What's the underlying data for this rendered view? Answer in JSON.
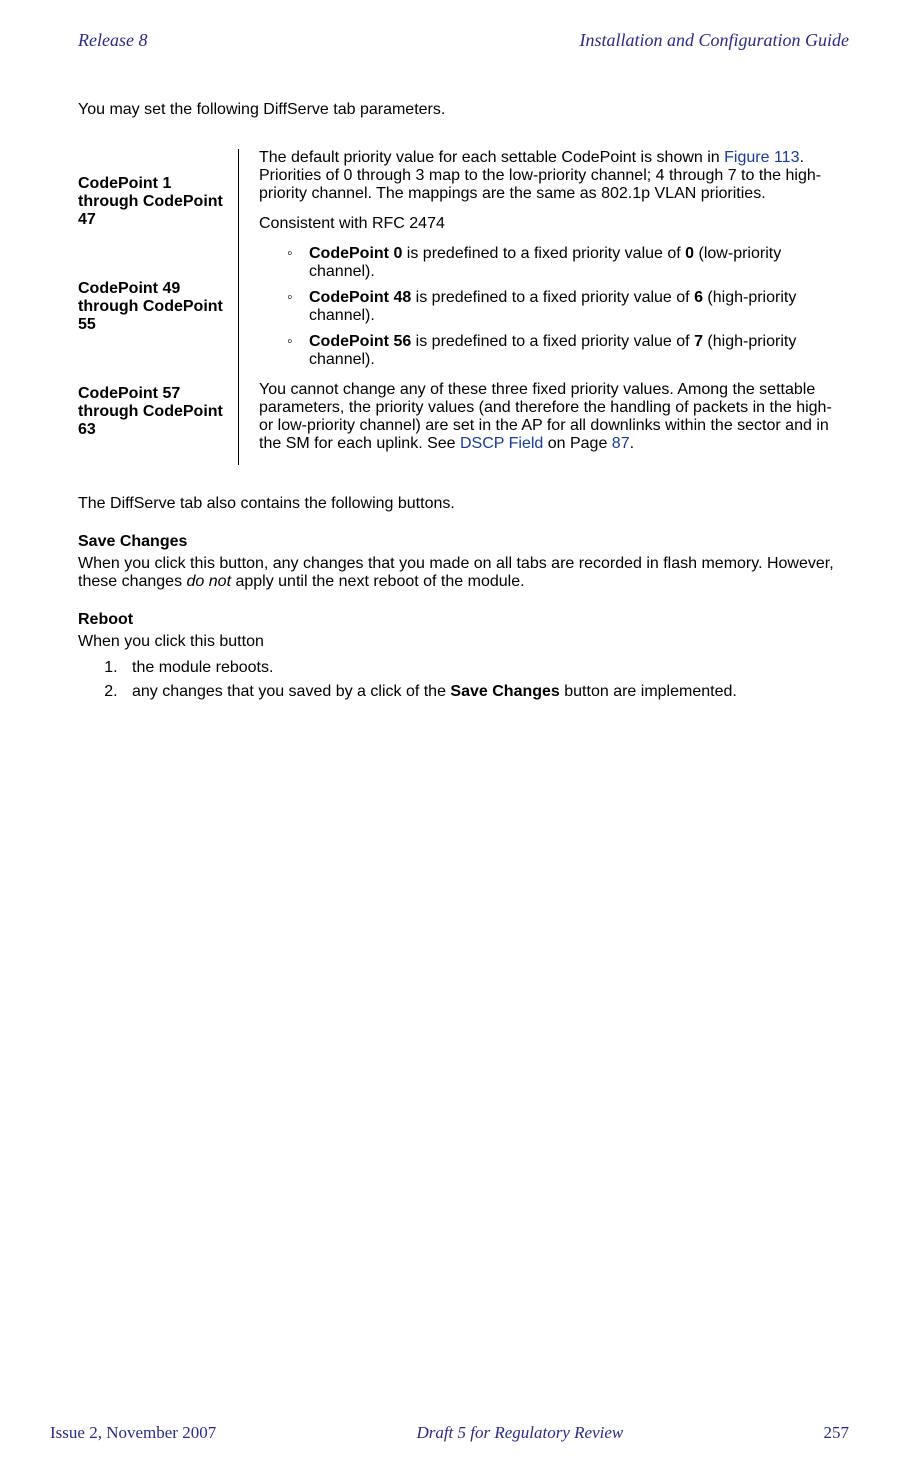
{
  "header": {
    "left": "Release 8",
    "right": "Installation and Configuration Guide"
  },
  "intro": "You may set the following DiffServe tab parameters.",
  "defs": {
    "left": [
      "CodePoint 1 through CodePoint 47",
      "CodePoint 49 through CodePoint 55",
      "CodePoint 57 through CodePoint 63"
    ],
    "p1_a": "The default priority value for each settable CodePoint is shown in ",
    "p1_link": "Figure 113",
    "p1_b": ". Priorities of 0 through 3 map to the low-priority channel; 4 through 7 to the high-priority channel. The mappings are the same as 802.1p VLAN priorities.",
    "p2": "Consistent with RFC 2474",
    "b1_a": "CodePoint 0",
    "b1_b": " is predefined to a fixed priority value of ",
    "b1_c": "0",
    "b1_d": " (low-priority channel).",
    "b2_a": "CodePoint 48",
    "b2_b": " is predefined to a fixed priority value of ",
    "b2_c": "6",
    "b2_d": " (high-priority channel).",
    "b3_a": "CodePoint 56",
    "b3_b": " is predefined to a fixed priority value of ",
    "b3_c": "7",
    "b3_d": " (high-priority channel).",
    "p3_a": "You cannot change any of these three fixed priority values. Among the settable parameters, the priority values (and therefore the handling of packets in the high- or low-priority channel) are set in the AP for all downlinks within the sector and in the SM for each uplink. See ",
    "p3_link": "DSCP Field",
    "p3_b": " on Page ",
    "p3_page": "87",
    "p3_c": "."
  },
  "after_table": "The DiffServe tab also contains the following buttons.",
  "save": {
    "title": "Save Changes",
    "body_a": "When you click this button, any changes that you made on all tabs are recorded in flash memory. However, these changes ",
    "body_em": "do not",
    "body_b": " apply until the next reboot of the module."
  },
  "reboot": {
    "title": "Reboot",
    "intro": "When you click this button",
    "li1": "the module reboots.",
    "li2_a": "any changes that you saved by a click of the ",
    "li2_b": "Save Changes",
    "li2_c": " button are implemented."
  },
  "footer": {
    "left": "Issue 2, November 2007",
    "center": "Draft 5 for Regulatory Review",
    "right": "257"
  }
}
